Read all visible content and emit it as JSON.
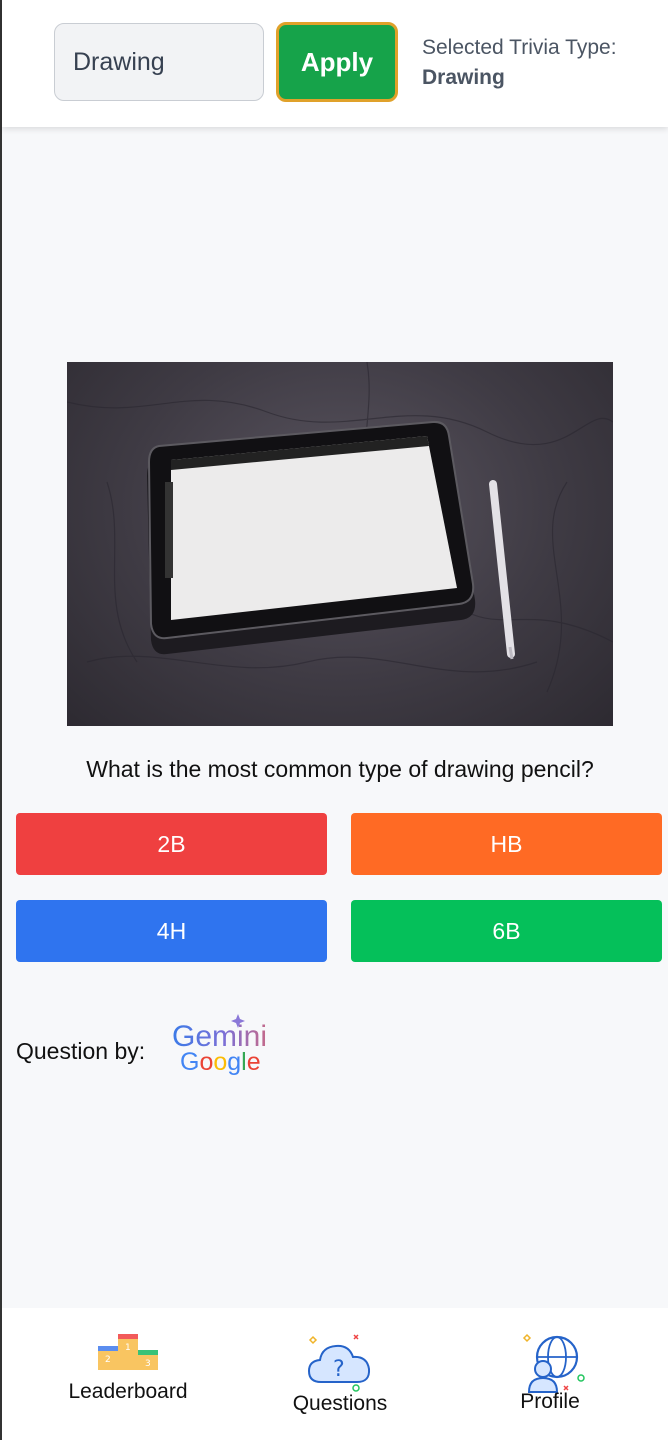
{
  "header": {
    "trivia_input_value": "Drawing",
    "apply_label": "Apply",
    "selected_type_label": "Selected Trivia Type:",
    "selected_type_value": "Drawing"
  },
  "question": {
    "text": "What is the most common type of drawing pencil?",
    "answers": [
      {
        "label": "2B",
        "color": "#ef4040"
      },
      {
        "label": "HB",
        "color": "#ff6a24"
      },
      {
        "label": "4H",
        "color": "#2f74ef"
      },
      {
        "label": "6B",
        "color": "#05c05a"
      }
    ]
  },
  "credit": {
    "label": "Question by:",
    "logo_line1": "Gemini",
    "logo_line2": "Google"
  },
  "nav": {
    "items": [
      {
        "label": "Leaderboard",
        "icon": "podium-icon"
      },
      {
        "label": "Questions",
        "icon": "cloud-question-icon"
      },
      {
        "label": "Profile",
        "icon": "globe-user-icon"
      }
    ]
  },
  "colors": {
    "apply_bg": "#16a34a",
    "apply_border": "#e0a12a"
  }
}
